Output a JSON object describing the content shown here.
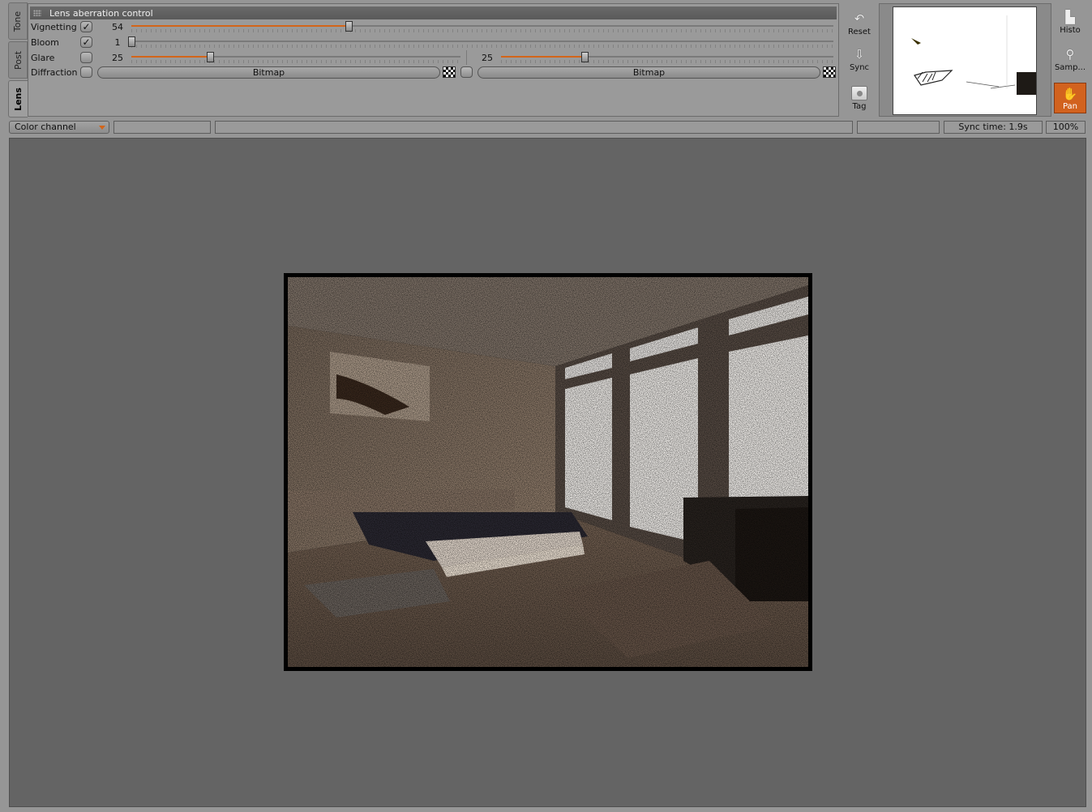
{
  "tabs": [
    {
      "label": "Tone",
      "active": false
    },
    {
      "label": "Post",
      "active": false
    },
    {
      "label": "Lens",
      "active": true
    }
  ],
  "panel": {
    "title": "Lens aberration control",
    "rows": {
      "vignetting": {
        "label": "Vignetting",
        "checked": true,
        "value": "54",
        "fraction": 0.31
      },
      "bloom": {
        "label": "Bloom",
        "checked": true,
        "value": "1",
        "fraction": 0.0
      },
      "glare": {
        "label": "Glare",
        "checked": false,
        "value": "25",
        "fraction": 0.24,
        "value2": "25",
        "fraction2": 0.25
      },
      "diffraction": {
        "label": "Diffraction",
        "checked": false,
        "bitmap1": "Bitmap",
        "bitmap2": "Bitmap"
      }
    }
  },
  "tools": {
    "reset": "Reset",
    "sync": "Sync",
    "tag": "Tag",
    "histo": "Histo",
    "sample": "Samp...",
    "pan": "Pan"
  },
  "status": {
    "channel": "Color channel",
    "field1": "",
    "field2": "",
    "field3": "",
    "sync_time": "Sync time:  1.9s",
    "zoom": "100%"
  },
  "colors": {
    "accent": "#d3651a",
    "viewport_bg": "#646464",
    "panel_bg": "#9a9a9a"
  }
}
